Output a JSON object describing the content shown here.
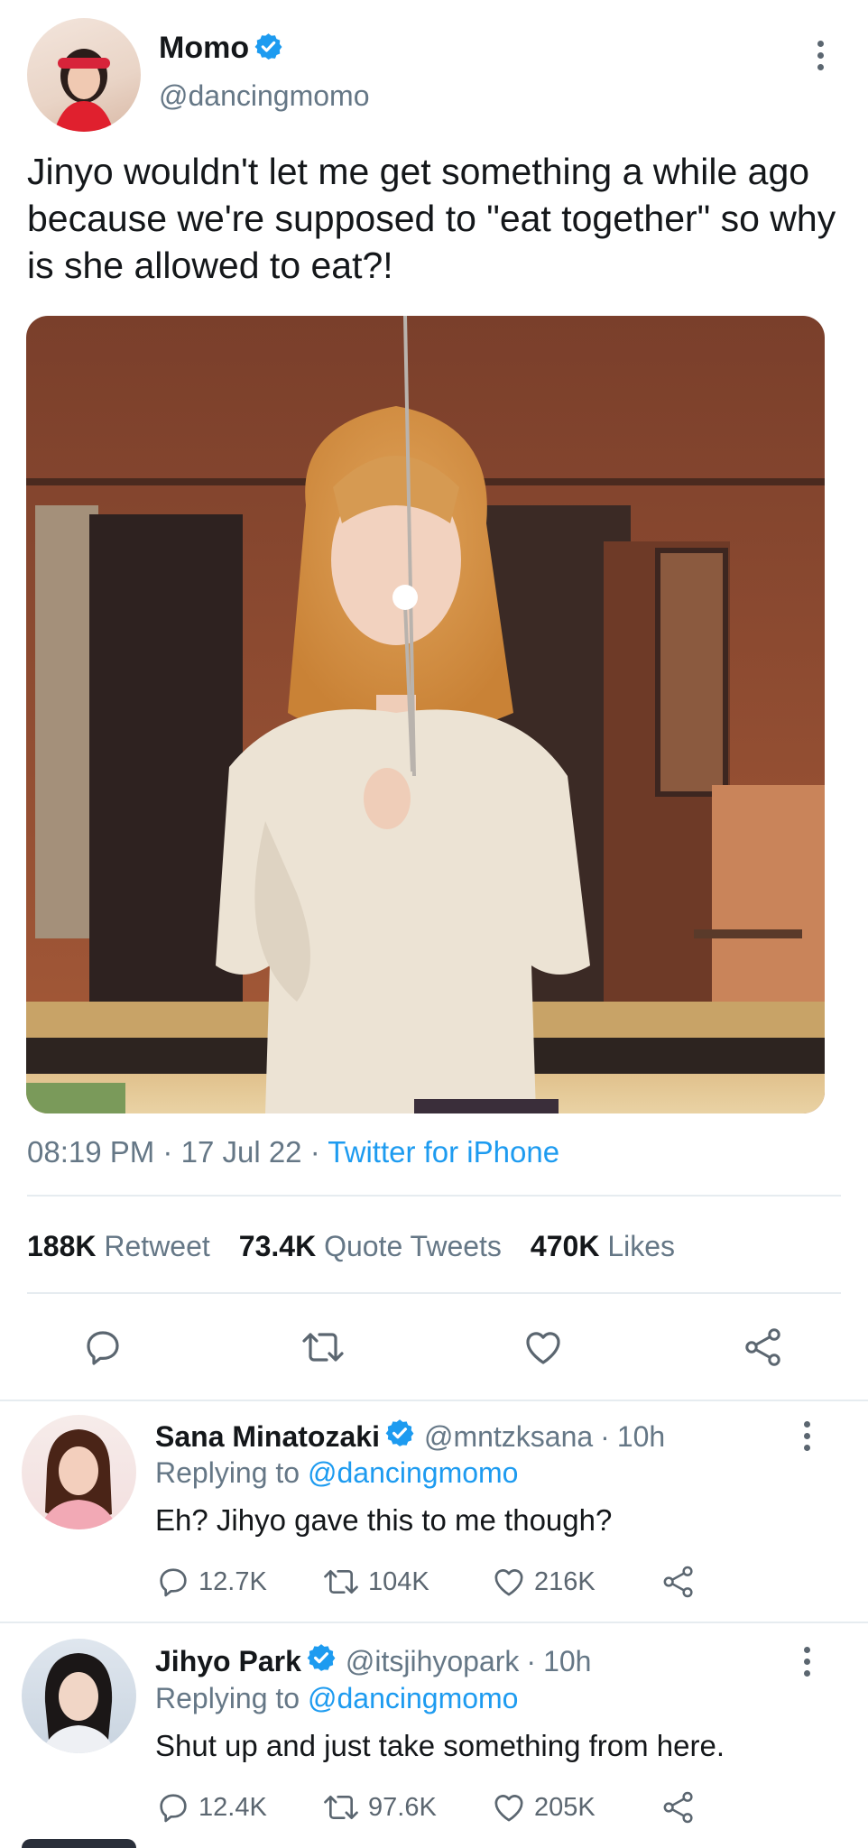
{
  "tweet": {
    "author_name": "Momo",
    "author_handle": "@dancingmomo",
    "text": "Jinyo wouldn't let me get something a while ago because we're supposed to \"eat together\" so why is she allowed to eat?!",
    "time": "08:19 PM",
    "date": "17 Jul 22",
    "sep1": "·",
    "sep2": "·",
    "source": "Twitter for iPhone",
    "stats": {
      "retweets_count": "188K",
      "retweets_label": "Retweet",
      "quotes_count": "73.4K",
      "quotes_label": "Quote Tweets",
      "likes_count": "470K",
      "likes_label": "Likes"
    },
    "icons": [
      "reply-icon",
      "retweet-icon",
      "like-icon",
      "share-icon"
    ]
  },
  "replies": [
    {
      "name": "Sana Minatozaki",
      "handle": "@mntzksana",
      "sep": "·",
      "time": "10h",
      "replying_label": "Replying to",
      "replying_to": "@dancingmomo",
      "text": "Eh? Jihyo gave this to me though?",
      "reply_count": "12.7K",
      "retweet_count": "104K",
      "like_count": "216K"
    },
    {
      "name": "Jihyo Park",
      "handle": "@itsjihyopark",
      "sep": "·",
      "time": "10h",
      "replying_label": "Replying to",
      "replying_to": "@dancingmomo",
      "text": "Shut up and just take something from here.",
      "reply_count": "12.4K",
      "retweet_count": "97.6K",
      "like_count": "205K"
    }
  ],
  "colors": {
    "accent": "#1d9bf0",
    "muted": "#657786",
    "divider": "#e6ecf0"
  }
}
